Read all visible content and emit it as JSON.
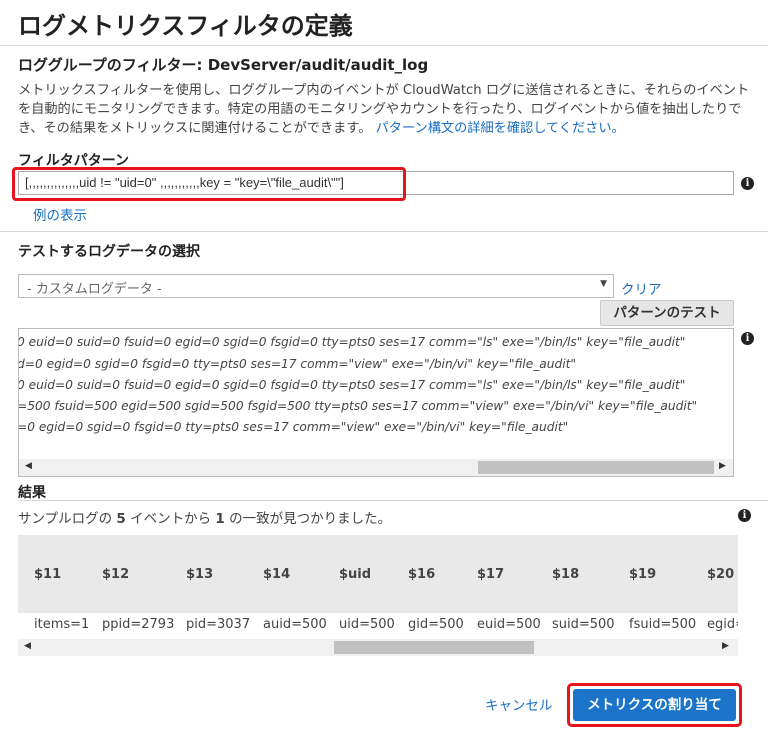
{
  "title": "ログメトリクスフィルタの定義",
  "filter_for": "ロググループのフィルター: DevServer/audit/audit_log",
  "description": "メトリックスフィルターを使用し、ロググループ内のイベントが CloudWatch ログに送信されるときに、それらのイベントを自動的にモニタリングできます。特定の用語のモニタリングやカウントを行ったり、ログイベントから値を抽出したりでき、その結果をメトリックスに関連付けることができます。",
  "description_link": "パターン構文の詳細を確認してください。",
  "filter_pattern": {
    "label": "フィルタパターン",
    "value": "[,,,,,,,,,,,,,,uid != \"uid=0\" ,,,,,,,,,,,key = \"key=\\\"file_audit\\\"\"]",
    "examples_link": "例の表示"
  },
  "test_data": {
    "label": "テストするログデータの選択",
    "select_value": "- カスタムログデータ -",
    "clear_link": "クリア",
    "test_button": "パターンのテスト",
    "lines": [
      "0 euid=0 suid=0 fsuid=0 egid=0 sgid=0 fsgid=0 tty=pts0 ses=17 comm=\"ls\" exe=\"/bin/ls\" key=\"file_audit\"",
      "d=0 egid=0 sgid=0 fsgid=0 tty=pts0 ses=17 comm=\"view\" exe=\"/bin/vi\" key=\"file_audit\"",
      "0 euid=0 suid=0 fsuid=0 egid=0 sgid=0 fsgid=0 tty=pts0 ses=17 comm=\"ls\" exe=\"/bin/ls\" key=\"file_audit\"",
      "=500 fsuid=500 egid=500 sgid=500 fsgid=500 tty=pts0 ses=17 comm=\"view\" exe=\"/bin/vi\" key=\"file_audit\"",
      "=0 egid=0 sgid=0 fsgid=0 tty=pts0 ses=17 comm=\"view\" exe=\"/bin/vi\" key=\"file_audit\""
    ]
  },
  "results": {
    "label": "結果",
    "summary_prefix": "サンプルログの ",
    "summary_total": "5",
    "summary_mid": " イベントから ",
    "summary_count": "1",
    "summary_suffix": " の一致が見つかりました。",
    "columns": [
      "$11",
      "$12",
      "$13",
      "$14",
      "$uid",
      "$16",
      "$17",
      "$18",
      "$19",
      "$20"
    ],
    "row": [
      "items=1",
      "ppid=2793",
      "pid=3037",
      "auid=500",
      "uid=500",
      "gid=500",
      "euid=500",
      "suid=500",
      "fsuid=500",
      "egid="
    ]
  },
  "actions": {
    "cancel": "キャンセル",
    "assign": "メトリクスの割り当て"
  },
  "colors": {
    "link": "#1a6ec2",
    "primary": "#1b74c9",
    "highlight": "#e8131b"
  }
}
